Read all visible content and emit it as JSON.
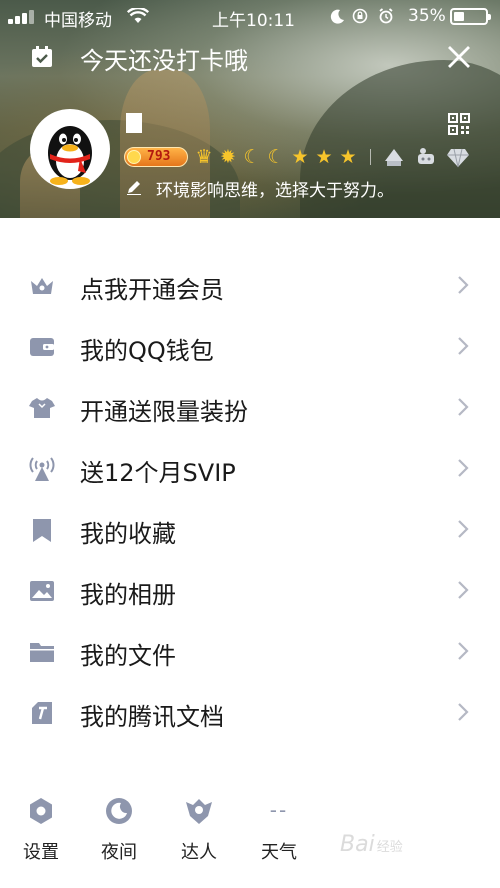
{
  "status_bar": {
    "carrier": "中国移动",
    "time": "上午10:11",
    "battery": "35%"
  },
  "header": {
    "checkin_text": "今天还没打卡哦",
    "points": "793",
    "signature": "环境影响思维，选择大于努力。"
  },
  "menu": {
    "items": [
      {
        "label": "点我开通会员",
        "icon": "crown-icon"
      },
      {
        "label": "我的QQ钱包",
        "icon": "wallet-icon"
      },
      {
        "label": "开通送限量装扮",
        "icon": "shirt-icon"
      },
      {
        "label": "送12个月SVIP",
        "icon": "broadcast-icon"
      },
      {
        "label": "我的收藏",
        "icon": "bookmark-icon"
      },
      {
        "label": "我的相册",
        "icon": "photo-icon"
      },
      {
        "label": "我的文件",
        "icon": "folder-icon"
      },
      {
        "label": "我的腾讯文档",
        "icon": "tencent-docs-icon"
      }
    ]
  },
  "bottom_bar": {
    "settings_label": "设置",
    "night_label": "夜间",
    "expert_label": "达人",
    "weather_label": "天气",
    "weather_value": "--"
  },
  "watermark": {
    "text": "Bai",
    "suffix": "经验"
  },
  "colors": {
    "icon": "#8e96ad",
    "text": "#1a1a1a",
    "chevron": "#b5b8c4",
    "level_gold": "#f7c52b"
  }
}
